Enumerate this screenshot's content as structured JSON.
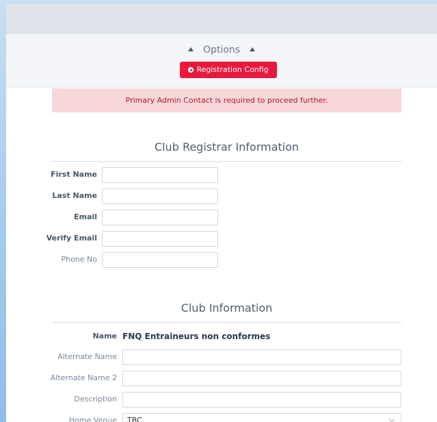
{
  "options": {
    "label": "Options",
    "registration_button": "Registration Config"
  },
  "alert": {
    "message": "Primary Admin Contact is required to proceed further."
  },
  "registrar_section": {
    "title": "Club Registrar Information",
    "fields": [
      {
        "label": "First Name",
        "value": ""
      },
      {
        "label": "Last Name",
        "value": ""
      },
      {
        "label": "Email",
        "value": ""
      },
      {
        "label": "Verify Email",
        "value": ""
      },
      {
        "label": "Phone No",
        "value": ""
      }
    ]
  },
  "club_section": {
    "title": "Club Information",
    "name_label": "Name",
    "name_value": "FNQ Entraineurs non conformes",
    "fields": [
      {
        "label": "Alternate Name",
        "value": ""
      },
      {
        "label": "Alternate Name 2",
        "value": ""
      },
      {
        "label": "Description",
        "value": ""
      }
    ],
    "home_venue": {
      "label": "Home Venue",
      "value": "TBC"
    }
  },
  "colors": {
    "accent_red": "#e8193c",
    "alert_bg": "#f8d7da",
    "alert_text": "#b11a2b"
  }
}
